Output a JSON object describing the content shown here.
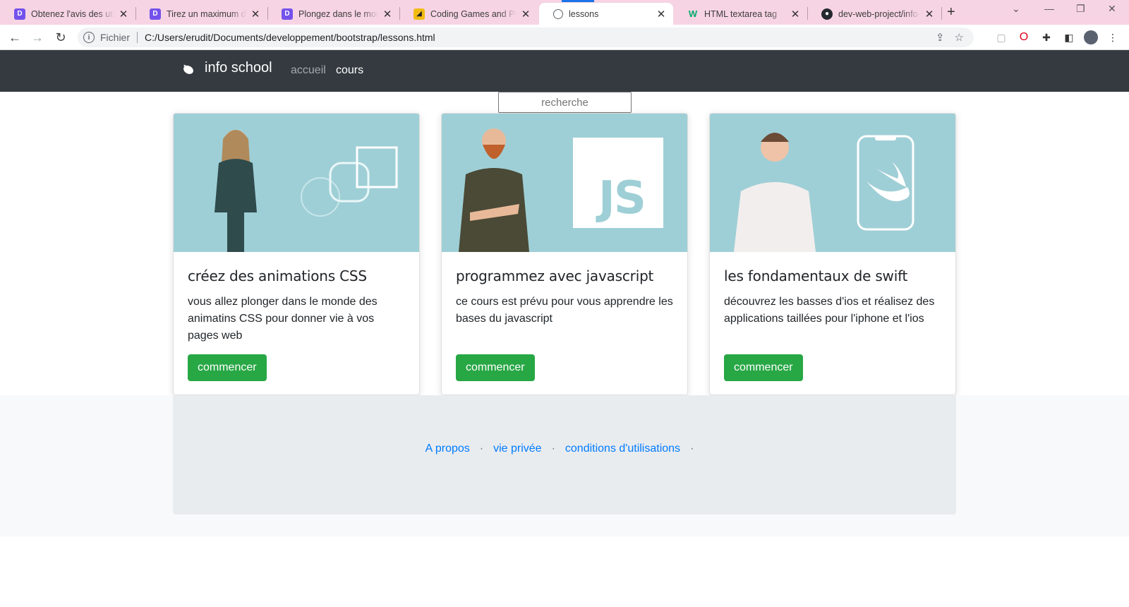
{
  "browser": {
    "tabs": [
      {
        "title": "Obtenez l'avis des utilisateurs",
        "favicon": "openclassrooms-icon",
        "color": "#7451eb"
      },
      {
        "title": "Tirez un maximum de ce cours",
        "favicon": "openclassrooms-icon",
        "color": "#7451eb"
      },
      {
        "title": "Plongez dans le monde",
        "favicon": "openclassrooms-icon",
        "color": "#7451eb"
      },
      {
        "title": "Coding Games and Programming Challenges",
        "favicon": "codingame-icon",
        "color": "#f2bb13"
      },
      {
        "title": "lessons",
        "favicon": "globe-icon",
        "color": "#5f6368"
      },
      {
        "title": "HTML textarea tag",
        "favicon": "w3schools-icon",
        "color": "#04aa6d"
      },
      {
        "title": "dev-web-project/info-school",
        "favicon": "github-icon",
        "color": "#24292f"
      }
    ],
    "new_tab": "+",
    "address": {
      "scheme": "Fichier",
      "url": "C:/Users/erudit/Documents/developpement/bootstrap/lessons.html"
    }
  },
  "navbar": {
    "brand": "info school",
    "links": [
      {
        "label": "accueil",
        "active": false
      },
      {
        "label": "cours",
        "active": true
      }
    ]
  },
  "search": {
    "placeholder": "recherche"
  },
  "cards": [
    {
      "title": "créez des animations CSS",
      "text": "vous allez plonger dans le monde des animatins CSS pour donner vie à vos pages web",
      "button": "commencer",
      "logo_text": ""
    },
    {
      "title": "programmez avec javascript",
      "text": "ce cours est prévu pour vous apprendre les bases du javascript",
      "button": "commencer",
      "logo_text": "JS"
    },
    {
      "title": "les fondamentaux de swift",
      "text": "découvrez les basses d'ios et réalisez des applications taillées pour l'iphone et l'ios",
      "button": "commencer",
      "logo_text": ""
    }
  ],
  "footer": {
    "links": [
      "A propos",
      "vie privée",
      "conditions d'utilisations"
    ],
    "separator": "·"
  },
  "colors": {
    "navbar": "#343a40",
    "card_image": "#9fcfd6",
    "button": "#28a745",
    "link": "#007bff",
    "tabbar": "#f7d4e3"
  }
}
